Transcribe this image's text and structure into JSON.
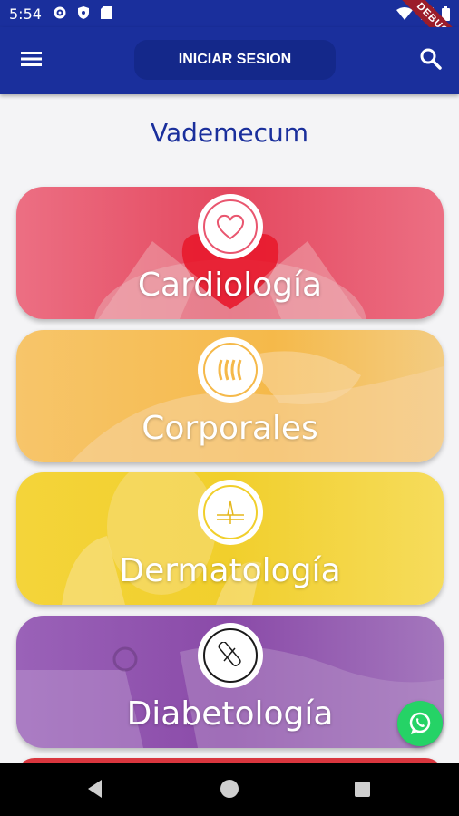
{
  "status_bar": {
    "time": "5:54",
    "left_icons": [
      "settings-icon",
      "shield-icon",
      "sd-card-icon"
    ],
    "right_icons": [
      "wifi-icon",
      "signal-icon",
      "battery-icon"
    ],
    "debug_label": "DEBUG"
  },
  "app_bar": {
    "menu_icon": "hamburger-menu-icon",
    "login_label": "INICIAR SESION",
    "search_icon": "search-icon"
  },
  "page": {
    "title": "Vademecum"
  },
  "categories": [
    {
      "label": "Cardiología",
      "icon": "heart-icon",
      "color": "#e9566f"
    },
    {
      "label": "Corporales",
      "icon": "body-lines-icon",
      "color": "#f5b94a"
    },
    {
      "label": "Dermatología",
      "icon": "skin-layer-icon",
      "color": "#f1cf2c"
    },
    {
      "label": "Diabetología",
      "icon": "thermometer-icon",
      "color": "#8a4aa8"
    }
  ],
  "fab": {
    "icon": "whatsapp-icon",
    "color": "#25d366"
  },
  "colors": {
    "primary": "#1a2f9c",
    "background": "#f4f4f6"
  }
}
